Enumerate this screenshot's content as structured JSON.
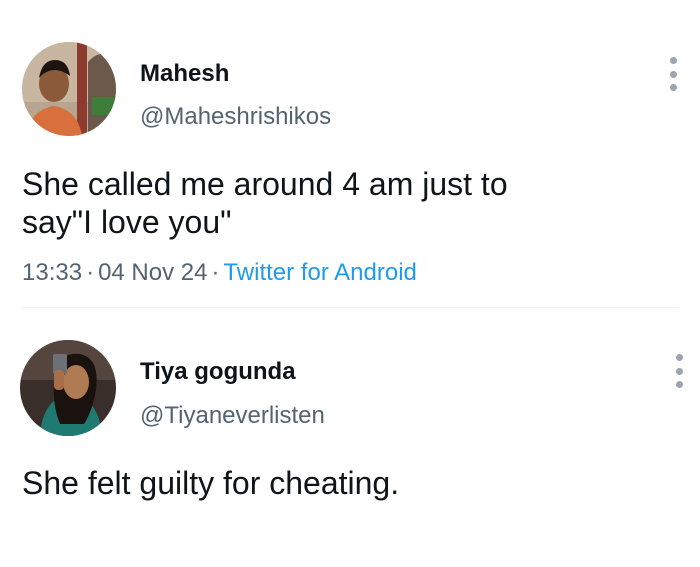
{
  "tweets": [
    {
      "display_name": "Mahesh",
      "handle": "@Maheshrishikos",
      "text_lines": [
        "She called me around 4 am just to",
        "say\"I love you\""
      ],
      "time": "13:33",
      "separator": "·",
      "date": "04 Nov 24",
      "source": "Twitter for Android",
      "avatar_icon": "avatar-photo",
      "more_icon": "more-vertical-icon"
    },
    {
      "display_name": "Tiya gogunda",
      "handle": "@Tiyaneverlisten",
      "text_lines": [
        "She felt guilty for cheating."
      ],
      "avatar_icon": "avatar-photo",
      "more_icon": "more-vertical-icon"
    }
  ],
  "colors": {
    "text_primary": "#0f1419",
    "text_secondary": "#536471",
    "link": "#1d9bf0",
    "icon_gray": "#9aa5b0"
  }
}
